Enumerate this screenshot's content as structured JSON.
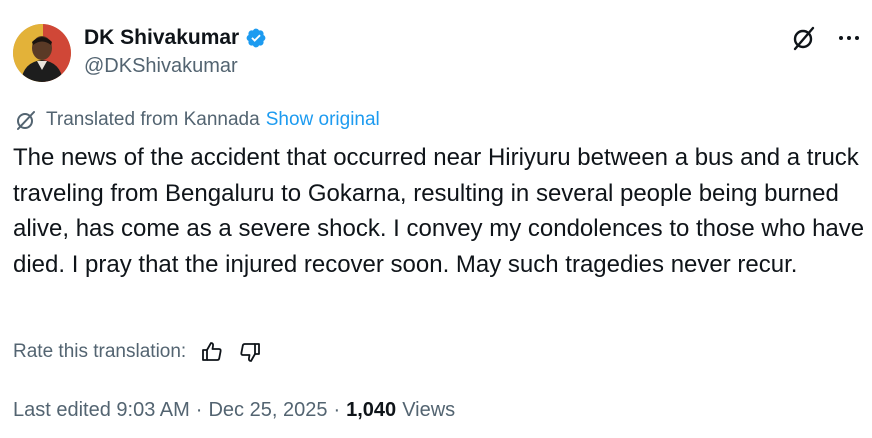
{
  "author": {
    "display_name": "DK Shivakumar",
    "handle": "@DKShivakumar",
    "verified": true
  },
  "icons": {
    "verified": "verified-badge-icon",
    "grok": "grok-icon",
    "more": "more-options-icon",
    "translate": "translate-icon",
    "thumbs_up": "thumbs-up-icon",
    "thumbs_down": "thumbs-down-icon"
  },
  "colors": {
    "accent": "#1d9bf0",
    "secondary_text": "#536471",
    "primary_text": "#0f1419"
  },
  "translation": {
    "label": "Translated from Kannada",
    "show_original": "Show original"
  },
  "tweet": {
    "text": "The news of the accident that occurred near Hiriyuru between a bus and a truck traveling from Bengaluru to Gokarna, resulting in several people being burned alive, has come as a severe shock. I convey my condolences to those who have died. I pray that the injured recover soon. May such tragedies never recur."
  },
  "rating": {
    "label": "Rate this translation:"
  },
  "meta": {
    "edited_time": "Last edited 9:03 AM",
    "separator": "·",
    "date": "Dec 25, 2025",
    "views_count": "1,040",
    "views_label": "Views"
  }
}
